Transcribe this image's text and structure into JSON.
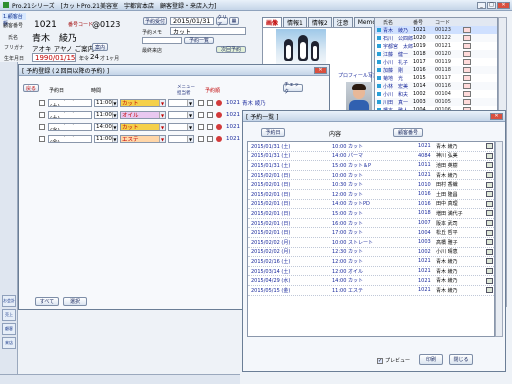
{
  "app": {
    "title": "Pro.21シリーズ　[カットPro.21美容室　宇都宮本店　顧客登録・来店入力]"
  },
  "customer": {
    "tab_label": "1.顧客台帳",
    "no_label": "顧客番号",
    "no_value": "1021",
    "member_label": "番号コード",
    "member_value": "0123",
    "name_label": "氏名",
    "name_value": "青木　綾乃",
    "kana_label": "フリガナ",
    "kana_value": "アオキ アヤノ ご案内",
    "birth_label": "生年月日",
    "birth_value": "1990/01/15",
    "age_label": "年令",
    "age_value": "24",
    "age_unit": "才",
    "month_value": "1ヶ月",
    "tel_label": "電話番号",
    "rank_label": "ランク",
    "rank_value": "A",
    "recv_btn": "予約受付",
    "date_value": "2015/01/31",
    "memo_label": "予約メモ",
    "service_value": "カット",
    "history_btn": "予約一覧",
    "next_btn": "次回予約",
    "last_label": "最終来店"
  },
  "right_tabs": [
    "画像",
    "情報1",
    "情報2",
    "注意",
    "Memo"
  ],
  "right_tabs_active": 0,
  "customer_list": {
    "header": [
      "氏名",
      "番号",
      "コード"
    ],
    "rows": [
      {
        "name": "青木　綾乃",
        "no": "1021",
        "code": "00123"
      },
      {
        "name": "石川　公四郎",
        "no": "1020",
        "code": "00122"
      },
      {
        "name": "宇都宮　太郎",
        "no": "1019",
        "code": "00121"
      },
      {
        "name": "江藤　健一",
        "no": "1018",
        "code": "00120"
      },
      {
        "name": "小川　礼子",
        "no": "1017",
        "code": "00119"
      },
      {
        "name": "加藤　剛",
        "no": "1016",
        "code": "00118"
      },
      {
        "name": "菊地　光",
        "no": "1015",
        "code": "00117"
      },
      {
        "name": "小林　宏美",
        "no": "1014",
        "code": "00116"
      },
      {
        "name": "小川　和夫",
        "no": "1002",
        "code": "00104"
      },
      {
        "name": "川田　真一",
        "no": "1003",
        "code": "00105"
      },
      {
        "name": "橋本　雅人",
        "no": "1004",
        "code": "00106"
      },
      {
        "name": "奈良　利子",
        "no": "1005",
        "code": "00107"
      },
      {
        "name": "中川　直子",
        "no": "1006",
        "code": "00108"
      },
      {
        "name": "野口　大輔",
        "no": "1007",
        "code": "00109"
      },
      {
        "name": "林　麻美",
        "no": "1008",
        "code": "00110"
      },
      {
        "name": "藤井　由紀",
        "no": "1009",
        "code": "00111"
      },
      {
        "name": "松田　恵",
        "no": "1010",
        "code": "00112"
      },
      {
        "name": "村上　幸子",
        "no": "1011",
        "code": "00113"
      },
      {
        "name": "森　健二",
        "no": "1012",
        "code": "00114"
      },
      {
        "name": "山本　愛",
        "no": "1013",
        "code": "00115"
      }
    ]
  },
  "reservation_window": {
    "title": "[ 予約登録 (２回目以降の予約) ]",
    "toolbar_btn1": "戻る",
    "toolbar_btn2": "チェック",
    "col_date": "予約日",
    "col_time": "時間",
    "col_menu": "メニュー",
    "col_staff": "担当者",
    "col_seq": "予約順",
    "rows": [
      {
        "date": "2015/03/14 (土)",
        "time": "11:00",
        "menu": "カット",
        "menu_color": "#f5d04a",
        "staff": "1021",
        "name": "青木 綾乃"
      },
      {
        "date": "2015/03/28 (土)",
        "time": "11:00",
        "menu": "オイル",
        "menu_color": "#e8c8f0",
        "staff": "1021",
        "name": ""
      },
      {
        "date": "2015/04/29 (水)",
        "time": "14:00",
        "menu": "カット",
        "menu_color": "#f5d04a",
        "staff": "1021",
        "name": ""
      },
      {
        "date": "2015/05/15 (金)",
        "time": "11:00",
        "menu": "エステ",
        "menu_color": "#ffd6a8",
        "staff": "1021",
        "name": ""
      }
    ],
    "btn_all": "すべて",
    "btn_close": "選択"
  },
  "list_window": {
    "title": "[ 予約一覧 ]",
    "btn_left": "予約日",
    "header_center": "内容",
    "btn_right": "顧客番号",
    "rows": [
      {
        "date": "2015/01/31 (土)",
        "content": "10:00 カット",
        "no": "1021",
        "name": "青木 綾乃"
      },
      {
        "date": "2015/01/31 (土)",
        "content": "14:00 パーマ",
        "no": "4084",
        "name": "神川 弘美"
      },
      {
        "date": "2015/01/31 (土)",
        "content": "15:00 カット＆P",
        "no": "1011",
        "name": "池田 英樹"
      },
      {
        "date": "2015/02/01 (日)",
        "content": "10:00 カット",
        "no": "1021",
        "name": "青木 綾乃"
      },
      {
        "date": "2015/02/01 (日)",
        "content": "10:30 カット",
        "no": "1010",
        "name": "田村 香織"
      },
      {
        "date": "2015/02/01 (日)",
        "content": "12:00 カット",
        "no": "1016",
        "name": "土田 隆昌"
      },
      {
        "date": "2015/02/01 (日)",
        "content": "14:00 カットPD",
        "no": "1016",
        "name": "田中 真理"
      },
      {
        "date": "2015/02/01 (日)",
        "content": "15:00 カット",
        "no": "1018",
        "name": "増田 満代子"
      },
      {
        "date": "2015/02/01 (日)",
        "content": "16:00 カット",
        "no": "1007",
        "name": "阪本 武司"
      },
      {
        "date": "2015/02/01 (日)",
        "content": "17:00 カット",
        "no": "1004",
        "name": "松丘 哲平"
      },
      {
        "date": "2015/02/02 (月)",
        "content": "10:00 ストレート",
        "no": "1003",
        "name": "高橋 雅子"
      },
      {
        "date": "2015/02/02 (月)",
        "content": "12:30 カット",
        "no": "1002",
        "name": "小川 晴恵"
      },
      {
        "date": "2015/02/16 (土)",
        "content": "12:00 カット",
        "no": "1021",
        "name": "青木 綾乃"
      },
      {
        "date": "2015/03/14 (土)",
        "content": "12:00 オイル",
        "no": "1021",
        "name": "青木 綾乃"
      },
      {
        "date": "2015/04/29 (水)",
        "content": "14:00 カット",
        "no": "1021",
        "name": "青木 綾乃"
      },
      {
        "date": "2015/05/15 (金)",
        "content": "11:00 エステ",
        "no": "1021",
        "name": "青木 綾乃"
      }
    ],
    "preview_label": "プレビュー",
    "btn_print": "印刷",
    "btn_close": "閉じる"
  },
  "side_buttons": [
    "お会計",
    "売上",
    "顧客",
    "来店",
    "予約"
  ],
  "profile_caption": "プロフィール写真",
  "icons": [
    "close-icon",
    "minimize-icon",
    "maximize-icon",
    "checkbox-icon",
    "calendar-icon"
  ]
}
